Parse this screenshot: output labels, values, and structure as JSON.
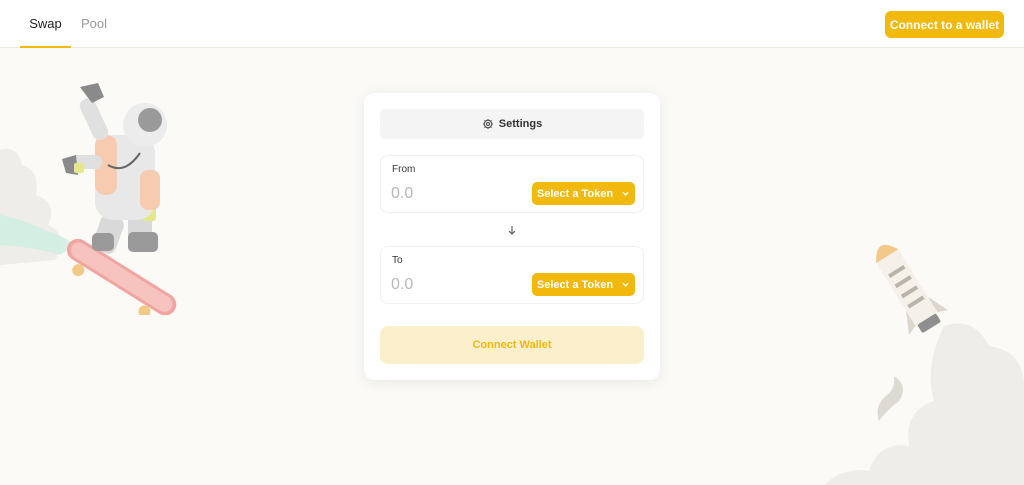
{
  "nav": {
    "tabs": [
      {
        "label": "Swap",
        "active": true
      },
      {
        "label": "Pool",
        "active": false
      }
    ],
    "connect_wallet_label": "Connect to a wallet"
  },
  "swap_card": {
    "settings_label": "Settings",
    "settings_icon": "gear-icon",
    "from": {
      "label": "From",
      "amount_placeholder": "0.0",
      "token_button_label": "Select a Token"
    },
    "to": {
      "label": "To",
      "amount_placeholder": "0.0",
      "token_button_label": "Select a Token"
    },
    "switch_icon": "arrow-down-icon",
    "connect_wallet_label": "Connect Wallet"
  },
  "theme": {
    "accent": "#f0b90b",
    "accent_light": "#fcefcc",
    "background": "#fbfaf6"
  },
  "illustrations": [
    "astronaut-skateboard-illustration",
    "rocket-illustration"
  ]
}
